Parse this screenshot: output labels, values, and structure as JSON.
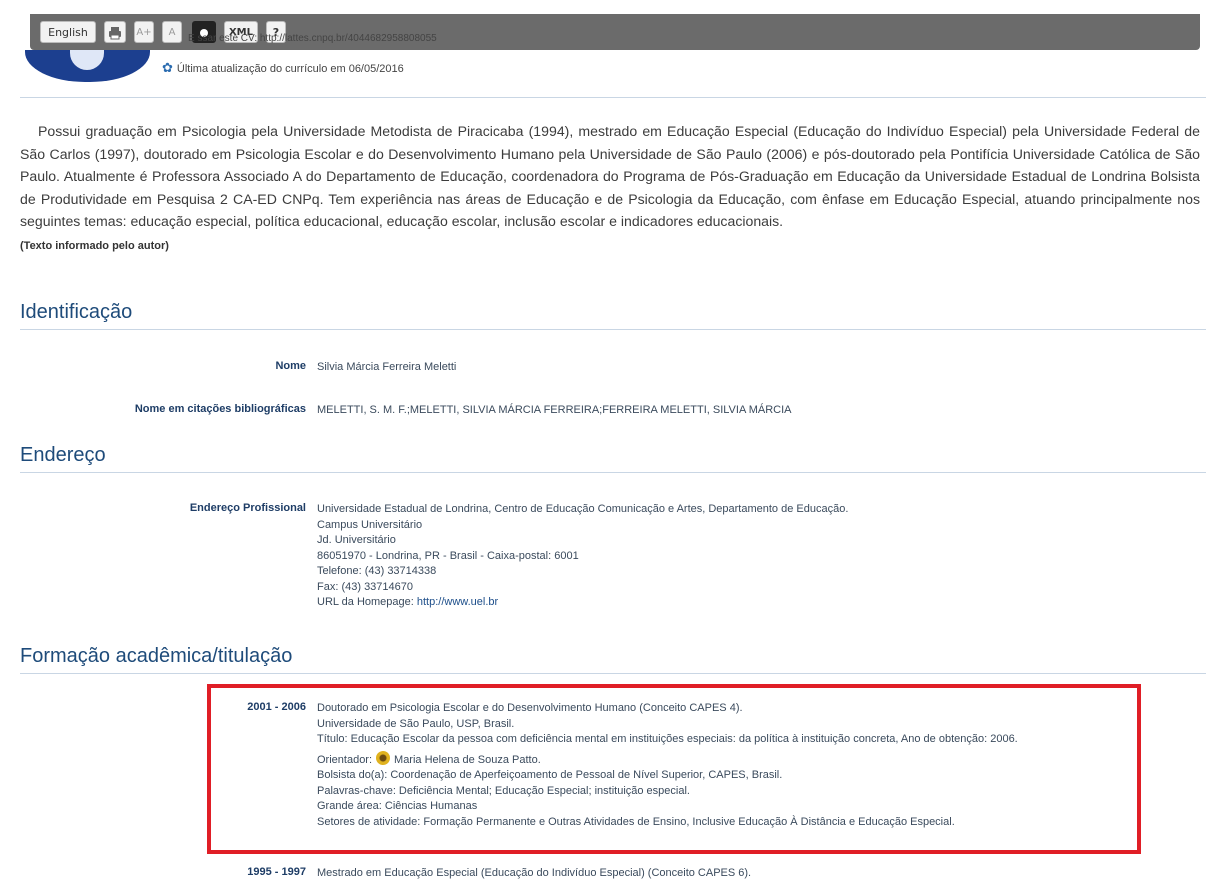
{
  "toolbar": {
    "english": "English",
    "aplus": "A+",
    "a": "A",
    "xml": "XML",
    "help": "?",
    "cv_url_text": "E           ssar este CV: http://lattes.cnpq.br/4044682958808055"
  },
  "header": {
    "update_text": "Última atualização do currículo em 06/05/2016"
  },
  "summary": {
    "text": "Possui graduação em Psicologia pela Universidade Metodista de Piracicaba (1994), mestrado em Educação Especial (Educação do Indivíduo Especial) pela Universidade Federal de São Carlos (1997), doutorado em Psicologia Escolar e do Desenvolvimento Humano pela Universidade de São Paulo (2006) e pós-doutorado pela Pontifícia Universidade Católica de São Paulo. Atualmente é Professora Associado A do Departamento de Educação, coordenadora do Programa de Pós-Graduação em Educação da Universidade Estadual de Londrina Bolsista de Produtividade em Pesquisa 2 CA-ED CNPq. Tem experiência nas áreas de Educação e de Psicologia da Educação, com ênfase em Educação Especial, atuando principalmente nos seguintes temas: educação especial, política educacional, educação escolar, inclusão escolar e indicadores educacionais.",
    "note": "(Texto informado pelo autor)"
  },
  "identificacao": {
    "title": "Identificação",
    "nome_label": "Nome",
    "nome_value": "Silvia Márcia Ferreira Meletti",
    "citacoes_label": "Nome em citações bibliográficas",
    "citacoes_value": "MELETTI, S. M. F.;MELETTI, SILVIA MÁRCIA FERREIRA;FERREIRA MELETTI, SILVIA MÁRCIA"
  },
  "endereco": {
    "title": "Endereço",
    "label": "Endereço Profissional",
    "line1": "Universidade Estadual de Londrina, Centro de Educação Comunicação e Artes, Departamento de Educação.",
    "line2": "Campus Universitário",
    "line3": "Jd. Universitário",
    "line4": "86051970 - Londrina, PR - Brasil - Caixa-postal: 6001",
    "line5": "Telefone: (43) 33714338",
    "line6": "Fax: (43) 33714670",
    "homepage_label": "URL da Homepage: ",
    "homepage_link": "http://www.uel.br"
  },
  "formacao": {
    "title": "Formação acadêmica/titulação",
    "entry1": {
      "years": "2001 - 2006",
      "line1": "Doutorado em Psicologia Escolar e do Desenvolvimento Humano (Conceito CAPES 4).",
      "line2": "Universidade de São Paulo, USP, Brasil.",
      "line3": "Título: Educação Escolar da pessoa com deficiência mental em instituições especiais: da política à instituição concreta, Ano de obtenção: 2006.",
      "orientador_label": "Orientador:",
      "orientador_name": "Maria Helena de Souza Patto.",
      "line5": "Bolsista do(a): Coordenação de Aperfeiçoamento de Pessoal de Nível Superior, CAPES, Brasil.",
      "line6": "Palavras-chave: Deficiência Mental; Educação Especial; instituição especial.",
      "line7": "Grande área: Ciências Humanas",
      "line8": "Setores de atividade: Formação Permanente e Outras Atividades de Ensino, Inclusive Educação À Distância e Educação Especial."
    },
    "entry2": {
      "years": "1995 - 1997",
      "line1": "Mestrado em Educação Especial (Educação do Indivíduo Especial) (Conceito CAPES 6)."
    }
  },
  "colors": {
    "section_title": "#1e4b7a",
    "highlight": "#e01e26"
  }
}
